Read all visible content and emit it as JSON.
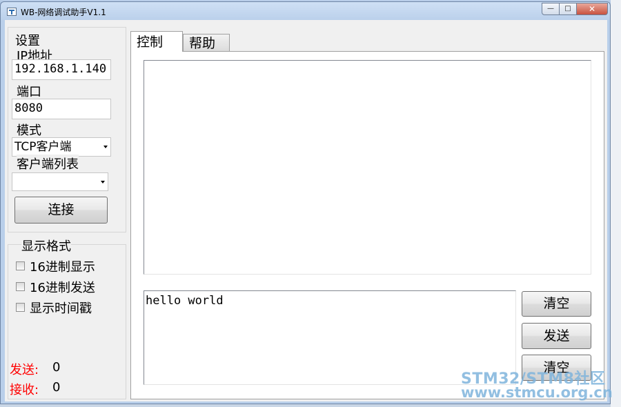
{
  "window": {
    "title": "WB-网络调试助手V1.1",
    "minimize_glyph": "—",
    "maximize_glyph": "□",
    "close_glyph": "✕"
  },
  "settings": {
    "group_label": "设置",
    "ip_label": "IP地址",
    "ip_value": "192.168.1.140",
    "port_label": "端口",
    "port_value": "8080",
    "mode_label": "模式",
    "mode_value": "TCP客户端",
    "client_list_label": "客户端列表",
    "client_list_value": "",
    "connect_button": "连接"
  },
  "display_format": {
    "group_label": "显示格式",
    "options": [
      {
        "label": "16进制显示",
        "checked": false
      },
      {
        "label": "16进制发送",
        "checked": false
      },
      {
        "label": "显示时间戳",
        "checked": false
      }
    ]
  },
  "status": {
    "send_label": "发送:",
    "send_count": "0",
    "receive_label": "接收:",
    "receive_count": "0"
  },
  "tabs": [
    {
      "label": "控制",
      "active": true
    },
    {
      "label": "帮助",
      "active": false
    }
  ],
  "control": {
    "receive_text": "",
    "send_text": "hello world",
    "clear_send_button": "清空",
    "send_button": "发送",
    "clear_receive_button": "清空"
  },
  "watermark": {
    "line1": "STM32/STM8社区",
    "line2": "www.stmcu.org.cn"
  },
  "colors": {
    "status_label": "#ff0000",
    "watermark": "#7fb4dc"
  }
}
